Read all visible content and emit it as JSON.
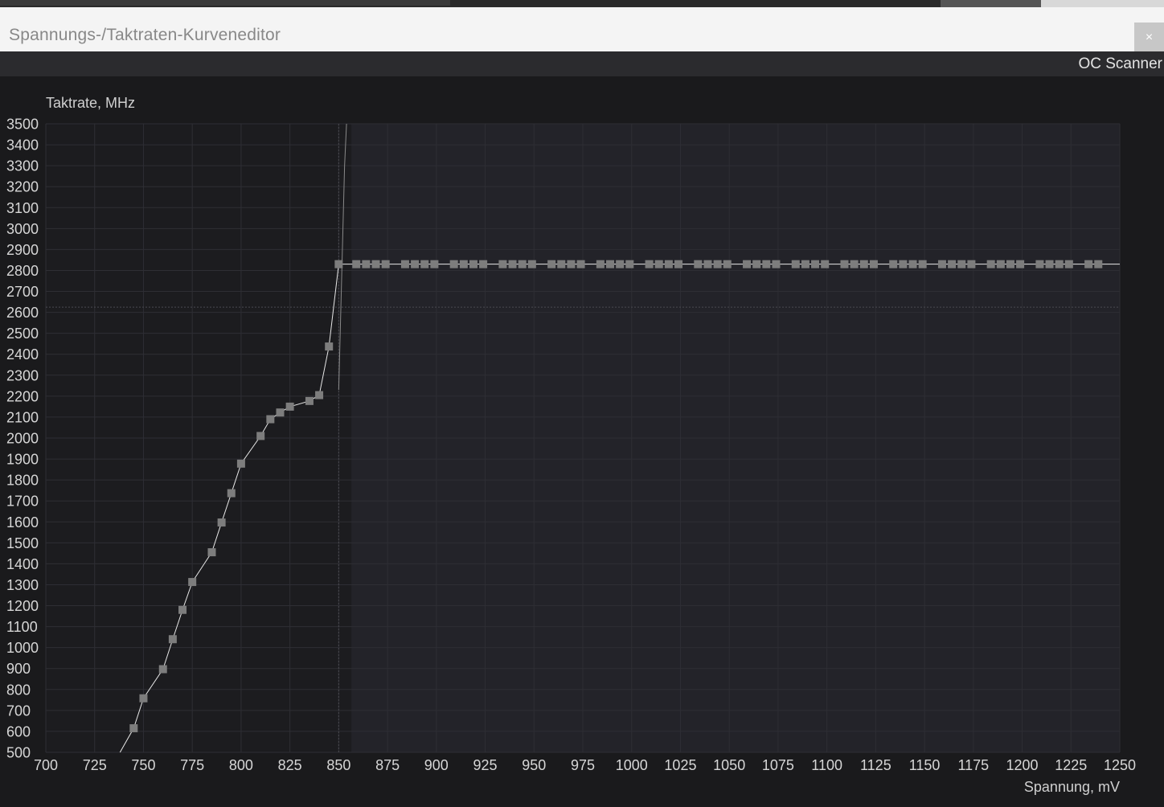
{
  "window": {
    "title": "Spannungs-/Taktraten-Kurveneditor",
    "close_glyph": "×"
  },
  "toolbar": {
    "oc_scanner_label": "OC Scanner"
  },
  "colors": {
    "plot_left_bg": "#1c1c1f",
    "plot_right_bg": "#232329",
    "curve": "#e8e8e8",
    "point": "#7d7d7d"
  },
  "chart_data": {
    "type": "line",
    "xlabel": "Spannung, mV",
    "ylabel": "Taktrate, MHz",
    "xlim": [
      700,
      1250
    ],
    "ylim": [
      500,
      3500
    ],
    "x_ticks": [
      700,
      725,
      750,
      775,
      800,
      825,
      850,
      875,
      900,
      925,
      950,
      975,
      1000,
      1025,
      1050,
      1075,
      1100,
      1125,
      1150,
      1175,
      1200,
      1225,
      1250
    ],
    "y_ticks": [
      500,
      600,
      700,
      800,
      900,
      1000,
      1100,
      1200,
      1300,
      1400,
      1500,
      1600,
      1700,
      1800,
      1900,
      2000,
      2100,
      2200,
      2300,
      2400,
      2500,
      2600,
      2700,
      2800,
      2900,
      3000,
      3100,
      3200,
      3300,
      3400,
      3500
    ],
    "grid": true,
    "current_point": {
      "x": 850,
      "y": 2625
    },
    "series": [
      {
        "points": [
          [
            745,
            615
          ],
          [
            750,
            758
          ],
          [
            760,
            897
          ],
          [
            765,
            1040
          ],
          [
            770,
            1180
          ],
          [
            775,
            1313
          ],
          [
            785,
            1455
          ],
          [
            790,
            1597
          ],
          [
            795,
            1737
          ],
          [
            800,
            1878
          ],
          [
            810,
            2010
          ],
          [
            815,
            2090
          ],
          [
            820,
            2122
          ],
          [
            825,
            2150
          ],
          [
            835,
            2177
          ],
          [
            840,
            2205
          ],
          [
            845,
            2437
          ],
          [
            850,
            2830
          ],
          [
            859,
            2830
          ],
          [
            864,
            2830
          ],
          [
            869,
            2830
          ],
          [
            874,
            2830
          ],
          [
            884,
            2830
          ],
          [
            889,
            2830
          ],
          [
            894,
            2830
          ],
          [
            899,
            2830
          ],
          [
            909,
            2830
          ],
          [
            914,
            2830
          ],
          [
            919,
            2830
          ],
          [
            924,
            2830
          ],
          [
            934,
            2830
          ],
          [
            939,
            2830
          ],
          [
            944,
            2830
          ],
          [
            949,
            2830
          ],
          [
            959,
            2830
          ],
          [
            964,
            2830
          ],
          [
            969,
            2830
          ],
          [
            974,
            2830
          ],
          [
            984,
            2830
          ],
          [
            989,
            2830
          ],
          [
            994,
            2830
          ],
          [
            999,
            2830
          ],
          [
            1009,
            2830
          ],
          [
            1014,
            2830
          ],
          [
            1019,
            2830
          ],
          [
            1024,
            2830
          ],
          [
            1034,
            2830
          ],
          [
            1039,
            2830
          ],
          [
            1044,
            2830
          ],
          [
            1049,
            2830
          ],
          [
            1059,
            2830
          ],
          [
            1064,
            2830
          ],
          [
            1069,
            2830
          ],
          [
            1074,
            2830
          ],
          [
            1084,
            2830
          ],
          [
            1089,
            2830
          ],
          [
            1094,
            2830
          ],
          [
            1099,
            2830
          ],
          [
            1109,
            2830
          ],
          [
            1114,
            2830
          ],
          [
            1119,
            2830
          ],
          [
            1124,
            2830
          ],
          [
            1134,
            2830
          ],
          [
            1139,
            2830
          ],
          [
            1144,
            2830
          ],
          [
            1149,
            2830
          ],
          [
            1159,
            2830
          ],
          [
            1164,
            2830
          ],
          [
            1169,
            2830
          ],
          [
            1174,
            2830
          ],
          [
            1184,
            2830
          ],
          [
            1189,
            2830
          ],
          [
            1194,
            2830
          ],
          [
            1199,
            2830
          ],
          [
            1209,
            2830
          ],
          [
            1214,
            2830
          ],
          [
            1219,
            2830
          ],
          [
            1224,
            2830
          ],
          [
            1234,
            2830
          ],
          [
            1239,
            2830
          ]
        ]
      }
    ]
  }
}
